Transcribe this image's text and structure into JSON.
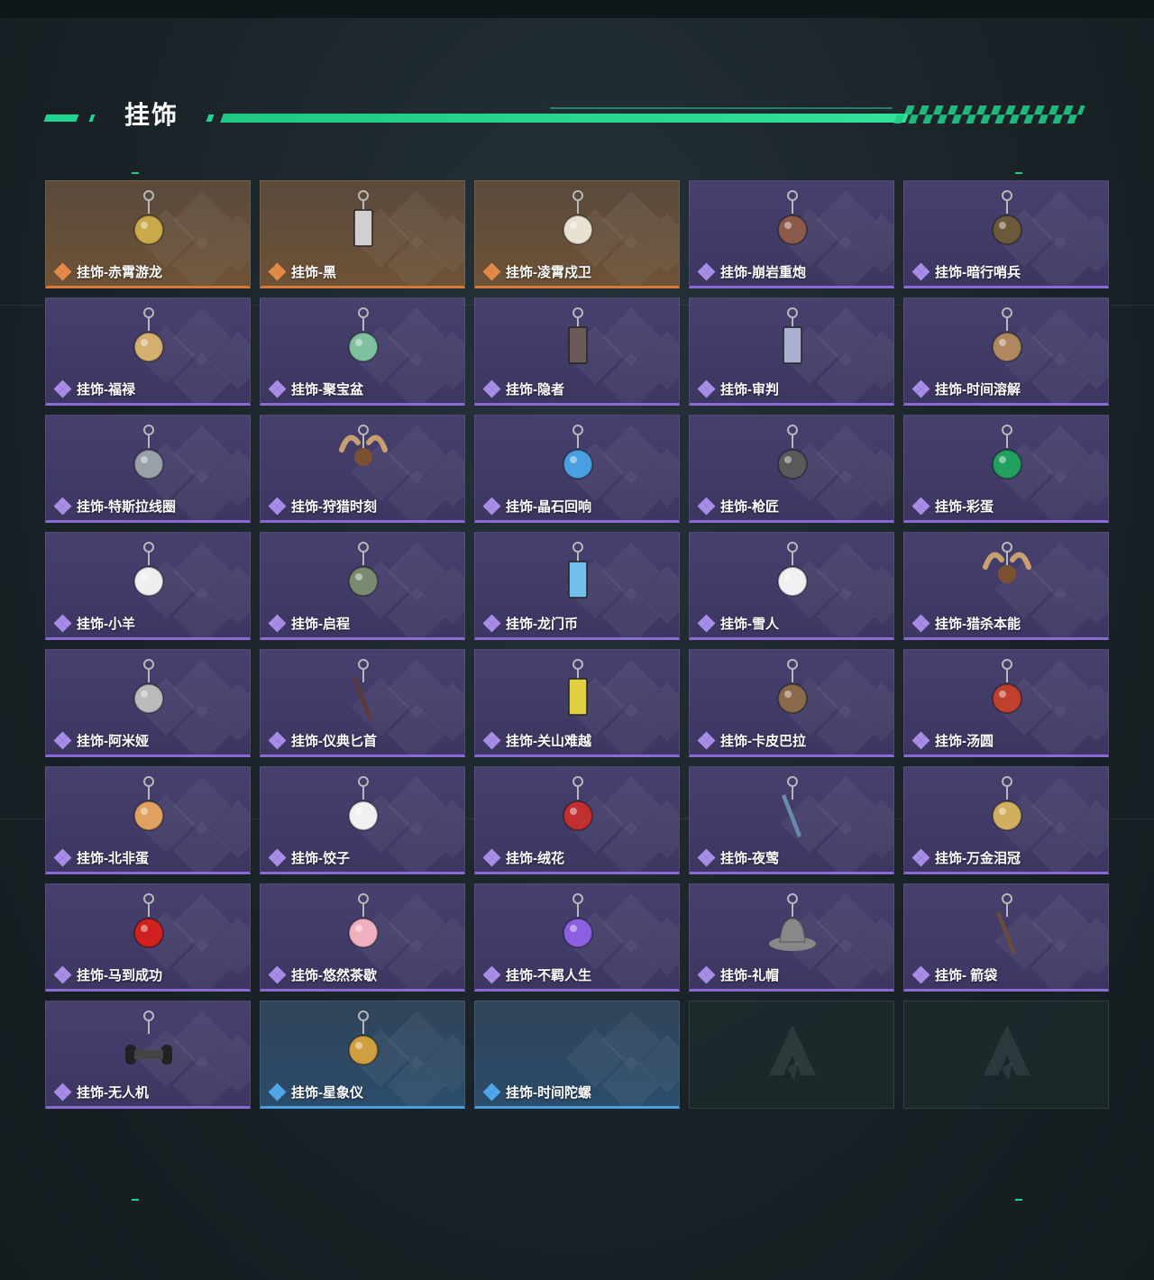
{
  "section": {
    "title": "挂饰"
  },
  "colors": {
    "accent": "#22d38f",
    "epic": "#8c6ad6",
    "legendary": "#d1783a",
    "rare": "#4a9fe0"
  },
  "items": [
    {
      "label": "挂饰-赤霄游龙",
      "rarity": "legendary",
      "icon": "dragon-figure-charm-icon"
    },
    {
      "label": "挂饰-黑",
      "rarity": "legendary",
      "icon": "card-tag-charm-icon"
    },
    {
      "label": "挂饰-凌霄戍卫",
      "rarity": "legendary",
      "icon": "guardian-figure-charm-icon"
    },
    {
      "label": "挂饰-崩岩重炮",
      "rarity": "epic",
      "icon": "soldier-figure-charm-icon"
    },
    {
      "label": "挂饰-暗行哨兵",
      "rarity": "epic",
      "icon": "sentinel-figure-charm-icon"
    },
    {
      "label": "挂饰-福禄",
      "rarity": "epic",
      "icon": "gourd-charm-icon"
    },
    {
      "label": "挂饰-聚宝盆",
      "rarity": "epic",
      "icon": "treasure-bowl-charm-icon"
    },
    {
      "label": "挂饰-隐者",
      "rarity": "epic",
      "icon": "tarot-card-charm-icon"
    },
    {
      "label": "挂饰-审判",
      "rarity": "epic",
      "icon": "tarot-card-charm-icon"
    },
    {
      "label": "挂饰-时间溶解",
      "rarity": "epic",
      "icon": "melting-clock-charm-icon"
    },
    {
      "label": "挂饰-特斯拉线圈",
      "rarity": "epic",
      "icon": "tesla-coil-charm-icon"
    },
    {
      "label": "挂饰-狩猎时刻",
      "rarity": "epic",
      "icon": "antlers-charm-icon"
    },
    {
      "label": "挂饰-晶石回响",
      "rarity": "epic",
      "icon": "crystal-charm-icon"
    },
    {
      "label": "挂饰-枪匠",
      "rarity": "epic",
      "icon": "toolbox-charm-icon"
    },
    {
      "label": "挂饰-彩蛋",
      "rarity": "epic",
      "icon": "green-egg-charm-icon"
    },
    {
      "label": "挂饰-小羊",
      "rarity": "epic",
      "icon": "sheep-charm-icon"
    },
    {
      "label": "挂饰-启程",
      "rarity": "epic",
      "icon": "medal-charm-icon"
    },
    {
      "label": "挂饰-龙门币",
      "rarity": "epic",
      "icon": "coin-card-charm-icon"
    },
    {
      "label": "挂饰-雪人",
      "rarity": "epic",
      "icon": "snowman-charm-icon"
    },
    {
      "label": "挂饰-猎杀本能",
      "rarity": "epic",
      "icon": "antlers-charm-icon"
    },
    {
      "label": "挂饰-阿米娅",
      "rarity": "epic",
      "icon": "bunny-charm-icon"
    },
    {
      "label": "挂饰-仪典匕首",
      "rarity": "epic",
      "icon": "dagger-charm-icon"
    },
    {
      "label": "挂饰-关山难越",
      "rarity": "epic",
      "icon": "can-charm-icon"
    },
    {
      "label": "挂饰-卡皮巴拉",
      "rarity": "epic",
      "icon": "capybara-charm-icon"
    },
    {
      "label": "挂饰-汤圆",
      "rarity": "epic",
      "icon": "dumpling-bowl-charm-icon"
    },
    {
      "label": "挂饰-北非蛋",
      "rarity": "epic",
      "icon": "pan-charm-icon"
    },
    {
      "label": "挂饰-饺子",
      "rarity": "epic",
      "icon": "dumpling-plate-charm-icon"
    },
    {
      "label": "挂饰-绒花",
      "rarity": "epic",
      "icon": "rose-charm-icon"
    },
    {
      "label": "挂饰-夜莺",
      "rarity": "epic",
      "icon": "feather-charm-icon"
    },
    {
      "label": "挂饰-万金泪冠",
      "rarity": "epic",
      "icon": "crown-charm-icon"
    },
    {
      "label": "挂饰-马到成功",
      "rarity": "epic",
      "icon": "red-horse-charm-icon"
    },
    {
      "label": "挂饰-悠然茶歇",
      "rarity": "epic",
      "icon": "cupcake-charm-icon"
    },
    {
      "label": "挂饰-不羁人生",
      "rarity": "epic",
      "icon": "sneaker-charm-icon"
    },
    {
      "label": "挂饰-礼帽",
      "rarity": "epic",
      "icon": "fedora-charm-icon"
    },
    {
      "label": "挂饰- 箭袋",
      "rarity": "epic",
      "icon": "quiver-charm-icon"
    },
    {
      "label": "挂饰-无人机",
      "rarity": "epic",
      "icon": "drone-charm-icon"
    },
    {
      "label": "挂饰-星象仪",
      "rarity": "rare",
      "icon": "astrolabe-charm-icon"
    },
    {
      "label": "挂饰-时间陀螺",
      "rarity": "rare",
      "icon": "gyroscope-charm-icon"
    }
  ],
  "empty_slots": [
    {
      "icon": "game-logo-icon"
    },
    {
      "icon": "game-logo-icon"
    }
  ]
}
